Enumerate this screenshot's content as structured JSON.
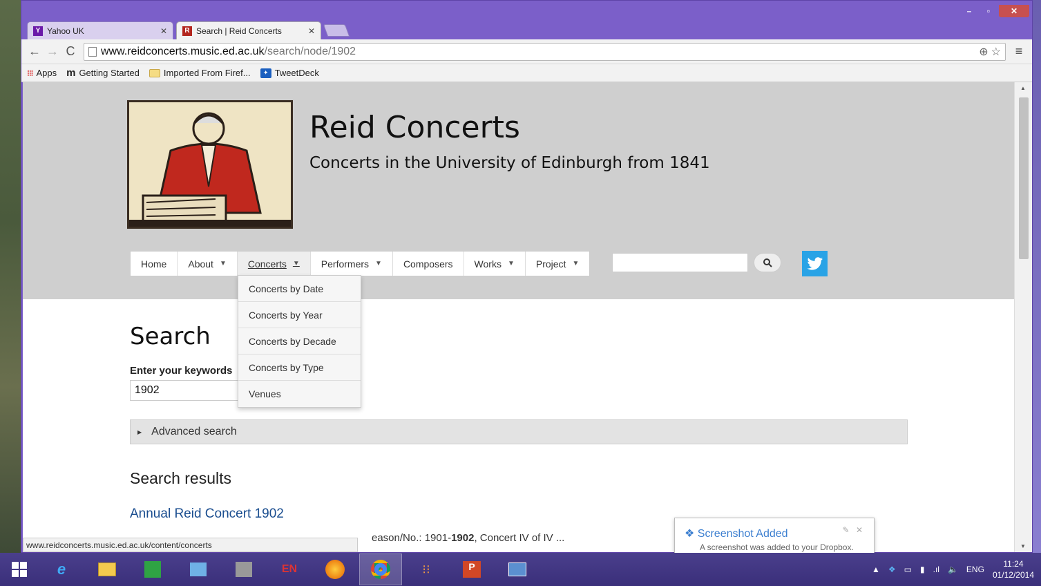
{
  "browser": {
    "tabs": [
      {
        "title": "Yahoo UK",
        "icon": "yahoo-icon",
        "active": false
      },
      {
        "title": "Search | Reid Concerts",
        "icon": "reid-concerts-favicon",
        "active": true
      }
    ],
    "url_host": "www.reidconcerts.music.ed.ac.uk",
    "url_path": "/search/node/1902",
    "bookmarks": [
      {
        "label": "Apps",
        "icon": "apps-grid-icon"
      },
      {
        "label": "Getting Started",
        "icon": "m-icon"
      },
      {
        "label": "Imported From Firef...",
        "icon": "folder-icon"
      },
      {
        "label": "TweetDeck",
        "icon": "tweetdeck-icon"
      }
    ],
    "status_url": "www.reidconcerts.music.ed.ac.uk/content/concerts"
  },
  "site": {
    "title": "Reid Concerts",
    "slogan": "Concerts in the University of Edinburgh from 1841",
    "nav": [
      {
        "label": "Home",
        "dropdown": false
      },
      {
        "label": "About",
        "dropdown": true
      },
      {
        "label": "Concerts",
        "dropdown": true,
        "open": true
      },
      {
        "label": "Performers",
        "dropdown": true
      },
      {
        "label": "Composers",
        "dropdown": false
      },
      {
        "label": "Works",
        "dropdown": true
      },
      {
        "label": "Project",
        "dropdown": true
      }
    ],
    "concerts_menu": [
      "Concerts by Date",
      "Concerts by Year",
      "Concerts by Decade",
      "Concerts by Type",
      "Venues"
    ]
  },
  "search": {
    "heading": "Search",
    "keywords_label": "Enter your keywords",
    "keywords_value": "1902",
    "advanced_label": "Advanced search",
    "results_heading": "Search results",
    "results": [
      {
        "title": "Annual Reid Concert 1902",
        "snippet_visible": "eason/No.:  1901-",
        "snippet_bold": "1902",
        "snippet_rest": ", Concert IV of IV ..."
      }
    ]
  },
  "toast": {
    "title": "Screenshot Added",
    "message": "A screenshot was added to your Dropbox."
  },
  "taskbar": {
    "lang": "ENG",
    "time": "11:24",
    "date": "01/12/2014"
  },
  "colors": {
    "window_frame": "#7b5fc9",
    "header_bg": "#cfcfcf",
    "link": "#1a4d8f",
    "twitter": "#29a3e6"
  }
}
